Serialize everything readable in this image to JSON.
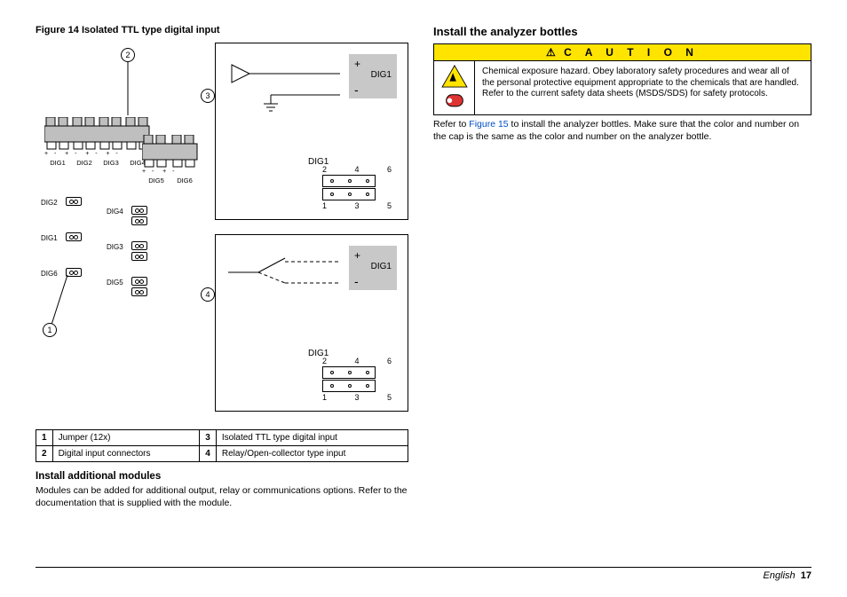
{
  "left": {
    "figure_label": "Figure 14  Isolated TTL type digital input",
    "callouts": {
      "c1": "1",
      "c2": "2",
      "c3": "3",
      "c4": "4"
    },
    "term_labels": {
      "d1": "DIG1",
      "d2": "DIG2",
      "d3": "DIG3",
      "d4": "DIG4",
      "d5": "DIG5",
      "d6": "DIG6"
    },
    "polarity": "+  -   +  -   +  -   +  -",
    "polarity2": "+  -   +  -",
    "jumper_labels": {
      "j_d1": "DIG1",
      "j_d2": "DIG2",
      "j_d3": "DIG3",
      "j_d4": "DIG4",
      "j_d5": "DIG5",
      "j_d6": "DIG6"
    },
    "panel": {
      "dig1": "DIG1",
      "plus": "+",
      "minus": "-",
      "side_label": "DIG1",
      "top_nums": "2   4   6",
      "bot_nums": "1   3   5"
    },
    "legend": {
      "r1n": "1",
      "r1t": "Jumper (12x)",
      "r2n": "2",
      "r2t": "Digital input connectors",
      "r3n": "3",
      "r3t": "Isolated TTL type digital input",
      "r4n": "4",
      "r4t": "Relay/Open-collector type input"
    },
    "sub_heading": "Install additional modules",
    "sub_para": "Modules can be added for additional output, relay or communications options. Refer to the documentation that is supplied with the module."
  },
  "right": {
    "heading": "Install the analyzer bottles",
    "caution_word": "C A U T I O N",
    "caution_icon_warn": "⚠",
    "caution_text": "Chemical exposure hazard. Obey laboratory safety procedures and wear all of the personal protective equipment appropriate to the chemicals that are handled. Refer to the current safety data sheets (MSDS/SDS) for safety protocols.",
    "refer_pre": "Refer to ",
    "refer_link": "Figure 15",
    "refer_post": " to install the analyzer bottles. Make sure that the color and number on the cap is the same as the color and number on the analyzer bottle."
  },
  "footer": {
    "lang": "English",
    "page": "17"
  }
}
